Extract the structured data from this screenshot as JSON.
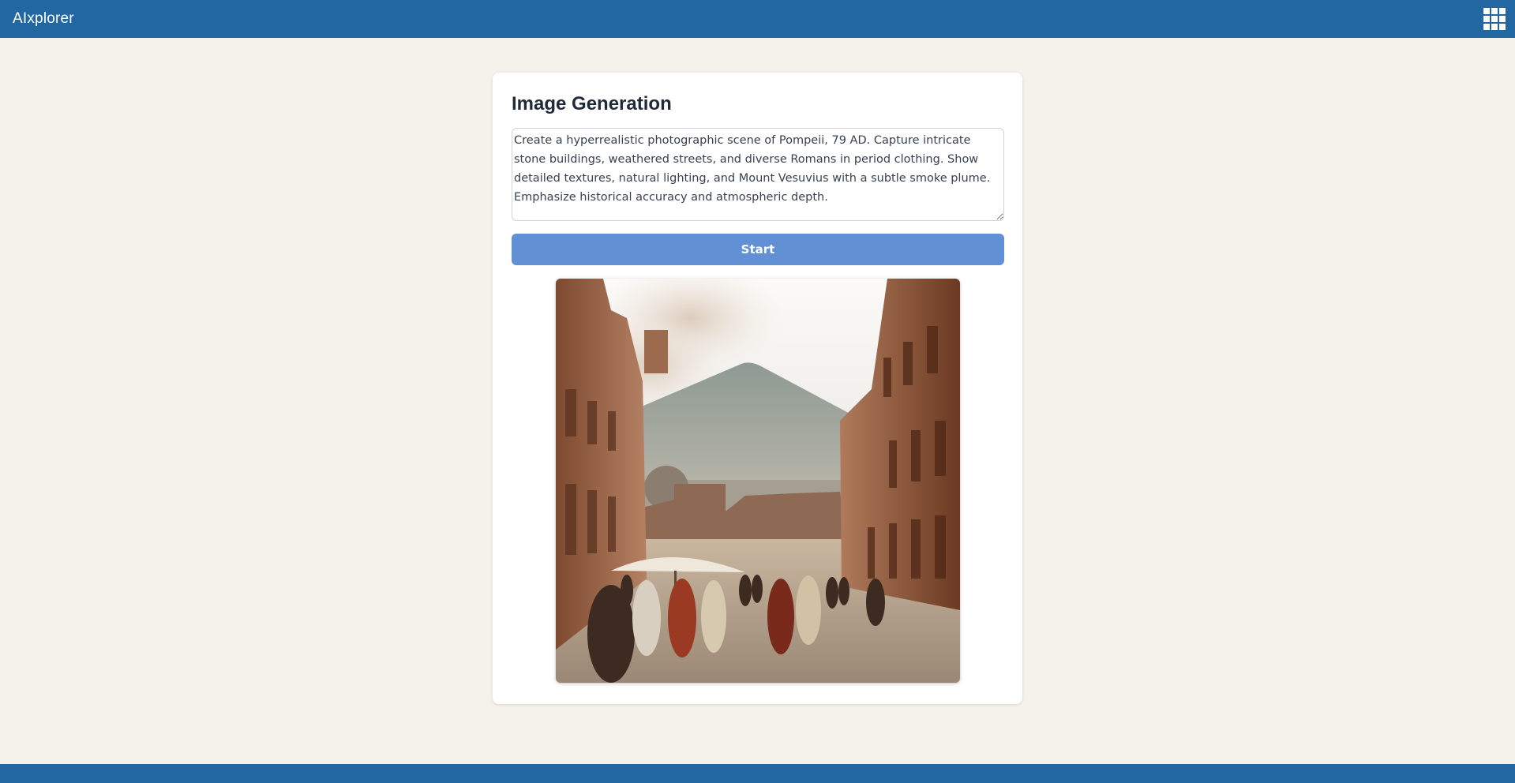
{
  "header": {
    "app_title": "AIxplorer",
    "menu_icon": "apps-grid-icon"
  },
  "card": {
    "title": "Image Generation",
    "prompt_value": "Create a hyperrealistic photographic scene of Pompeii, 79 AD. Capture intricate stone buildings, weathered streets, and diverse Romans in period clothing. Show detailed textures, natural lighting, and Mount Vesuvius with a subtle smoke plume. Emphasize historical accuracy and atmospheric depth.",
    "start_label": "Start"
  },
  "colors": {
    "brand": "#2266a2",
    "page_bg": "#f5f2ec",
    "button": "#6190d4"
  }
}
